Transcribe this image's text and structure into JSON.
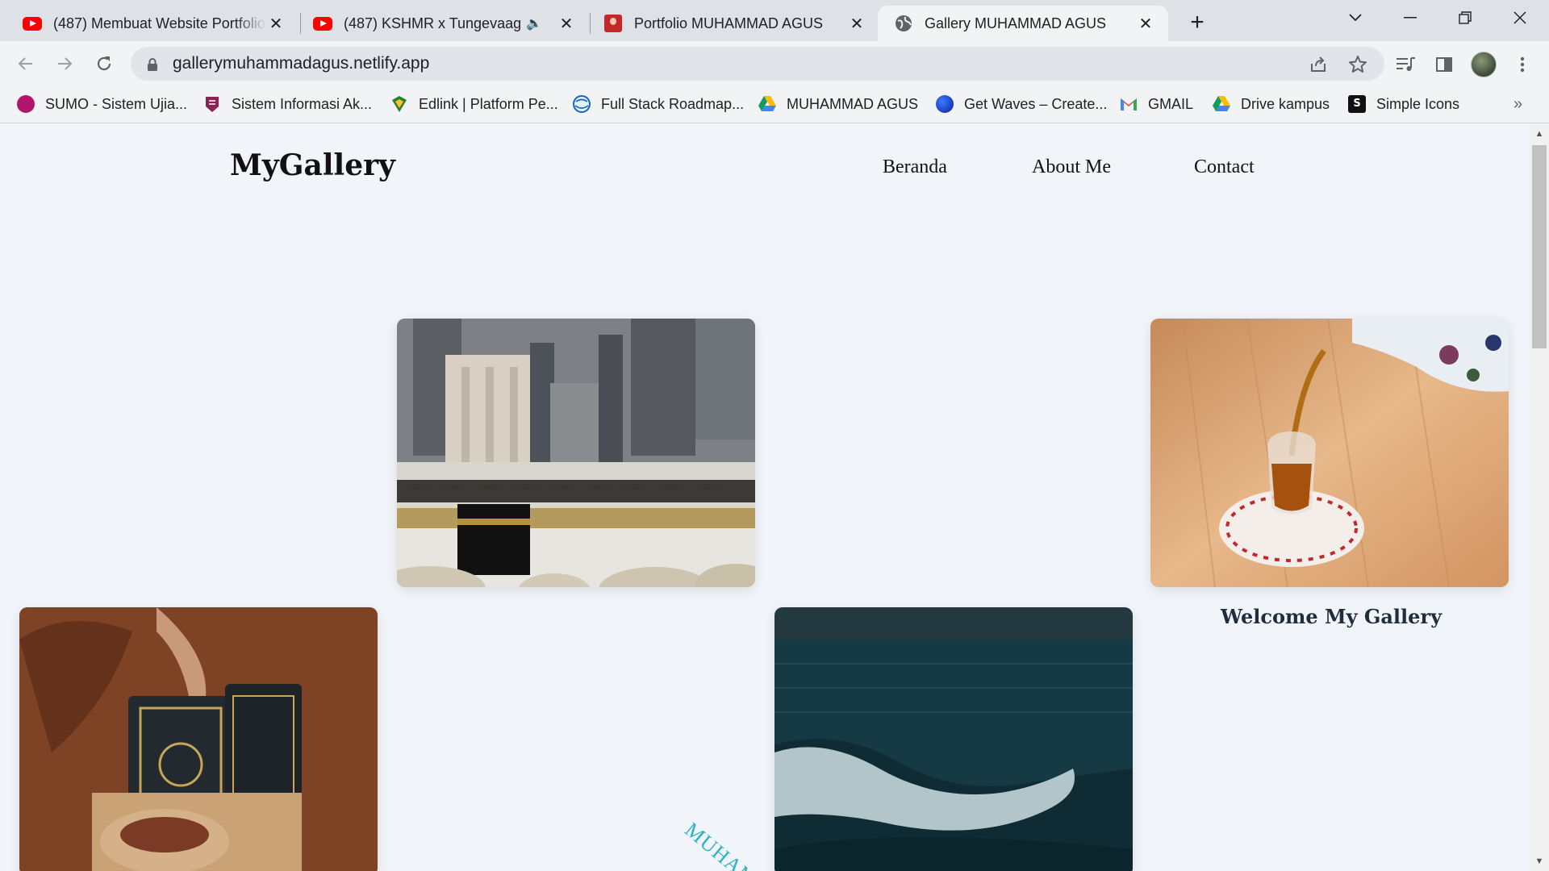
{
  "browser": {
    "tabs": [
      {
        "title": "(487) Membuat Website Portfolio",
        "icon": "youtube-icon"
      },
      {
        "title": "(487) KSHMR x Tungevaag - ",
        "icon": "youtube-icon"
      },
      {
        "title": "Portfolio MUHAMMAD AGUS",
        "icon": "portfolio-favicon"
      },
      {
        "title": "Gallery MUHAMMAD AGUS",
        "icon": "globe-icon"
      }
    ],
    "address": "gallerymuhammadagus.netlify.app",
    "bookmarks": [
      {
        "label": "SUMO - Sistem Ujia...",
        "icon": "sumo-icon",
        "color": "#b0166a"
      },
      {
        "label": "Sistem Informasi Ak...",
        "icon": "campus-icon",
        "color": "#8b2252"
      },
      {
        "label": "Edlink | Platform Pe...",
        "icon": "edlink-icon",
        "color": "#2e7d32"
      },
      {
        "label": "Full Stack Roadmap...",
        "icon": "roadmap-icon",
        "color": "#1565c0"
      },
      {
        "label": "MUHAMMAD AGUS",
        "icon": "drive-icon",
        "color": "#fbbc04"
      },
      {
        "label": "Get Waves – Create...",
        "icon": "waves-icon",
        "color": "#1a3fd1"
      },
      {
        "label": "GMAIL",
        "icon": "gmail-icon",
        "color": "#ea4335"
      },
      {
        "label": "Drive kampus",
        "icon": "drive-icon",
        "color": "#fbbc04"
      },
      {
        "label": "Simple Icons",
        "icon": "simpleicons-icon",
        "color": "#111111"
      }
    ],
    "more_bookmarks": "»"
  },
  "site": {
    "brand": "MyGallery",
    "nav": [
      "Beranda",
      "About Me",
      "Contact"
    ],
    "welcome": "Welcome My Gallery",
    "typing_text": "MUHAM"
  },
  "gallery": [
    {
      "name": "kaaba-photo",
      "alt": "Masjidil Haram"
    },
    {
      "name": "tea-photo",
      "alt": "Teh"
    },
    {
      "name": "quran-photo",
      "alt": "Al-Quran"
    },
    {
      "name": "ocean-photo",
      "alt": "Ombak laut"
    }
  ]
}
